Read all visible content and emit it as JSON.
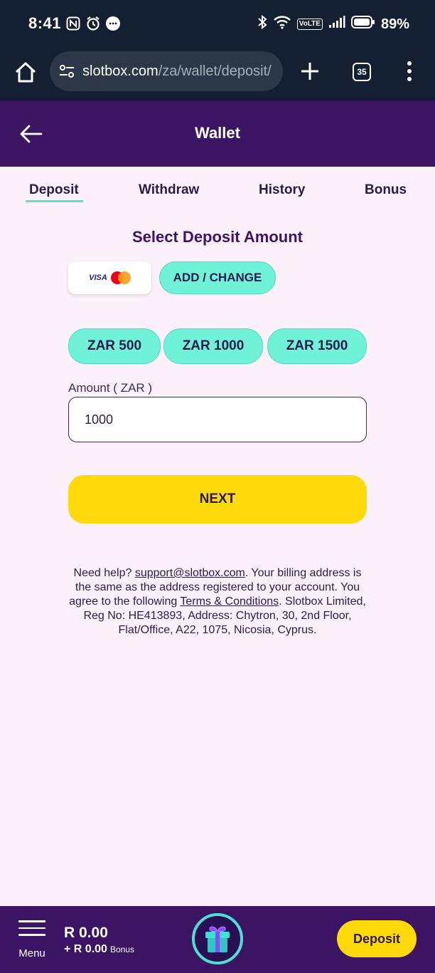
{
  "status_bar": {
    "time": "8:41",
    "battery": "89%",
    "network_badge": "VoLTE",
    "icons": [
      "nfc-icon",
      "alarm-icon",
      "chat-icon",
      "bluetooth-icon",
      "wifi-icon",
      "signal-icon",
      "battery-icon"
    ]
  },
  "browser": {
    "url_host": "slotbox.com",
    "url_path": "/za/wallet/deposit/",
    "tab_count": "35"
  },
  "header": {
    "title": "Wallet"
  },
  "tabs": [
    {
      "label": "Deposit",
      "active": true
    },
    {
      "label": "Withdraw",
      "active": false
    },
    {
      "label": "History",
      "active": false
    },
    {
      "label": "Bonus",
      "active": false
    }
  ],
  "deposit": {
    "section_title": "Select Deposit Amount",
    "card_brand": "VISA",
    "add_change_label": "ADD / CHANGE",
    "amount_options": [
      "ZAR 500",
      "ZAR 1000",
      "ZAR 1500"
    ],
    "amount_label": "Amount ( ZAR )",
    "amount_value": "1000",
    "next_label": "NEXT"
  },
  "help": {
    "prefix": "Need help? ",
    "support_email": "support@slotbox.com",
    "middle": ". Your billing address is the same as the address registered to your account. You agree to the following ",
    "terms_link": "Terms & Conditions",
    "suffix": ". Slotbox Limited, Reg No: HE413893, Address: Chytron, 30, 2nd Floor, Flat/Office, A22, 1075, Nicosia, Cyprus."
  },
  "bottom_nav": {
    "menu_label": "Menu",
    "balance": "R 0.00",
    "bonus_balance": "+ R 0.00",
    "bonus_label": "Bonus",
    "deposit_label": "Deposit"
  },
  "colors": {
    "status_bg": "#142032",
    "brand_purple": "#3b1464",
    "page_bg": "#fcf1fb",
    "mint": "#6ff2d8",
    "yellow": "#ffd90a"
  }
}
